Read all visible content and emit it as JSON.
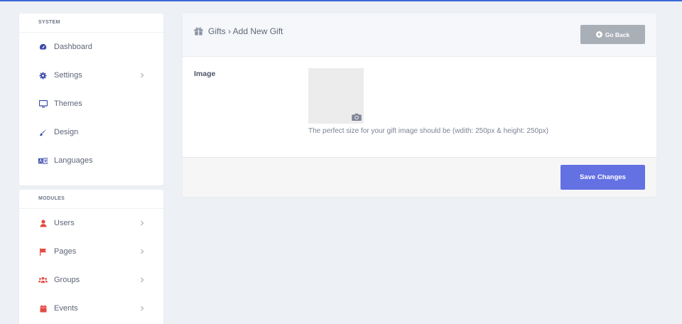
{
  "sidebar": {
    "system": {
      "title": "SYSTEM",
      "items": [
        {
          "label": "Dashboard",
          "icon": "gauge-icon",
          "has_chevron": false
        },
        {
          "label": "Settings",
          "icon": "gear-icon",
          "has_chevron": true
        },
        {
          "label": "Themes",
          "icon": "monitor-icon",
          "has_chevron": false
        },
        {
          "label": "Design",
          "icon": "paintbrush-icon",
          "has_chevron": false
        },
        {
          "label": "Languages",
          "icon": "language-icon",
          "has_chevron": false
        }
      ]
    },
    "modules": {
      "title": "MODULES",
      "items": [
        {
          "label": "Users",
          "icon": "user-icon",
          "has_chevron": true
        },
        {
          "label": "Pages",
          "icon": "flag-icon",
          "has_chevron": true
        },
        {
          "label": "Groups",
          "icon": "users-icon",
          "has_chevron": true
        },
        {
          "label": "Events",
          "icon": "calendar-icon",
          "has_chevron": true
        }
      ]
    }
  },
  "header": {
    "breadcrumb": "Gifts › Add New Gift",
    "go_back_label": "Go Back"
  },
  "form": {
    "image_label": "Image",
    "image_hint": "The perfect size for your gift image should be (wdith: 250px & height: 250px)",
    "save_label": "Save Changes"
  },
  "colors": {
    "accent_blue": "#3c68d8",
    "system_icon": "#3b4ba8",
    "module_icon": "#e24a40",
    "primary_button": "#6471e3",
    "secondary_button": "#a9afb7"
  }
}
